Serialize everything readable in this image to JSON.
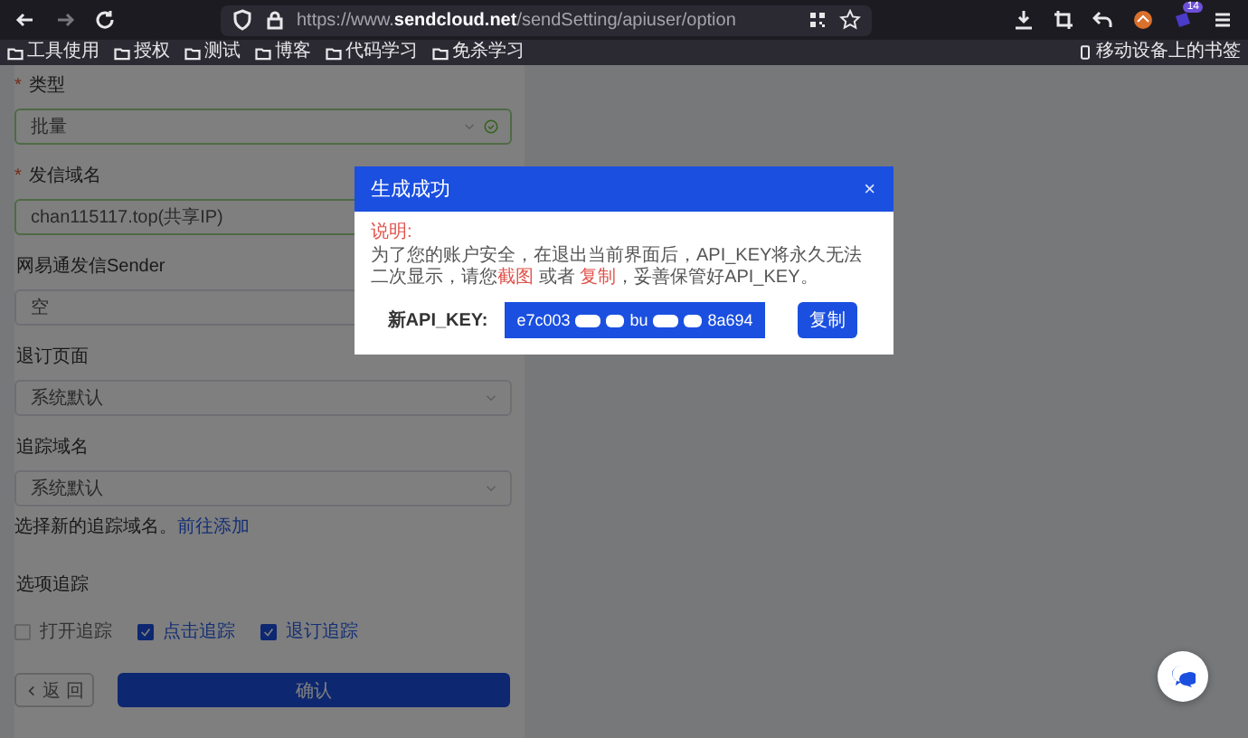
{
  "browser": {
    "url": "https://www.**sendcloud.net**/sendSetting/apiuser/option",
    "extension_badge": "14",
    "bookmarks": [
      {
        "label": "工具使用"
      },
      {
        "label": "授权"
      },
      {
        "label": "测试"
      },
      {
        "label": "博客"
      },
      {
        "label": "代码学习"
      },
      {
        "label": "免杀学习"
      }
    ],
    "mobile_bookmarks": "移动设备上的书签"
  },
  "form": {
    "fields": [
      {
        "label": "类型",
        "required_mark": "*",
        "kind": "select",
        "value": "批量",
        "valid": true
      },
      {
        "label": "发信域名",
        "required_mark": "*",
        "kind": "input",
        "value": "chan115117.top(共享IP)",
        "valid": true
      },
      {
        "label": "网易通发信Sender",
        "kind": "input",
        "value": "空",
        "valid": false
      },
      {
        "label": "退订页面",
        "kind": "select",
        "value": "系统默认",
        "valid": false
      },
      {
        "label": "追踪域名",
        "kind": "select",
        "value": "系统默认",
        "valid": false
      }
    ],
    "hint": "选择新的追踪域名。",
    "hint_link": "前往添加",
    "tracking_label": "选项追踪",
    "tracking": [
      {
        "label": "打开追踪",
        "checked": false
      },
      {
        "label": "点击追踪",
        "checked": true
      },
      {
        "label": "退订追踪",
        "checked": true
      }
    ],
    "back_button": "返 回",
    "confirm_button": "确认"
  },
  "dialog": {
    "title": "生成成功",
    "close": "×",
    "note_title": "说明:",
    "note": [
      {
        "text": "为了您的账户安全，在退出当前界面后，API_KEY将永久无法二次显示，请您",
        "kind": "plain"
      },
      {
        "text": "截图",
        "kind": "highlight"
      },
      {
        "text": " 或者 ",
        "kind": "plain"
      },
      {
        "text": "复制",
        "kind": "highlight"
      },
      {
        "text": "，妥善保管好API_KEY。",
        "kind": "plain"
      }
    ],
    "key_label": "新API_KEY:",
    "key_parts": [
      "e7c003",
      "bu",
      "8a694"
    ],
    "copy_button": "复制"
  }
}
